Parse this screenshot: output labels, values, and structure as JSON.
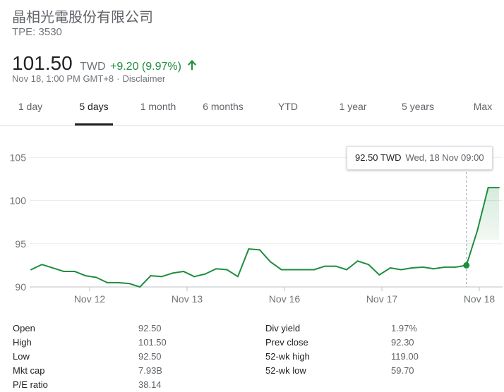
{
  "header": {
    "name": "晶相光電股份有限公司",
    "ticker": "TPE: 3530",
    "price": "101.50",
    "currency": "TWD",
    "change": "+9.20 (9.97%)",
    "timestamp": "Nov 18, 1:00 PM GMT+8",
    "separator": "·",
    "disclaimer": "Disclaimer",
    "up_color": "#1e8e3e",
    "arrow_icon": "arrow-up-icon"
  },
  "tabs": [
    {
      "label": "1 day",
      "active": false
    },
    {
      "label": "5 days",
      "active": true
    },
    {
      "label": "1 month",
      "active": false
    },
    {
      "label": "6 months",
      "active": false
    },
    {
      "label": "YTD",
      "active": false
    },
    {
      "label": "1 year",
      "active": false
    },
    {
      "label": "5 years",
      "active": false
    },
    {
      "label": "Max",
      "active": false
    }
  ],
  "tooltip": {
    "price": "92.50 TWD",
    "date": "Wed, 18 Nov 09:00"
  },
  "chart_data": {
    "type": "area",
    "y_ticks": [
      "105",
      "100",
      "95",
      "90"
    ],
    "ylim": [
      90,
      106
    ],
    "x_ticks": [
      "Nov 12",
      "Nov 13",
      "Nov 16",
      "Nov 17",
      "Nov 18"
    ],
    "series": [
      {
        "color": "#1e8e3e",
        "points": [
          [
            "Nov 11",
            92.0
          ],
          [
            "Nov 11",
            92.6
          ],
          [
            "Nov 11",
            92.2
          ],
          [
            "Nov 11",
            91.8
          ],
          [
            "Nov 12",
            91.8
          ],
          [
            "Nov 12",
            91.3
          ],
          [
            "Nov 12",
            91.1
          ],
          [
            "Nov 12",
            90.5
          ],
          [
            "Nov 12",
            90.5
          ],
          [
            "Nov 12",
            90.4
          ],
          [
            "Nov 12",
            90.0
          ],
          [
            "Nov 13",
            91.3
          ],
          [
            "Nov 13",
            91.2
          ],
          [
            "Nov 13",
            91.6
          ],
          [
            "Nov 13",
            91.8
          ],
          [
            "Nov 13",
            91.2
          ],
          [
            "Nov 13",
            91.5
          ],
          [
            "Nov 13",
            92.1
          ],
          [
            "Nov 13",
            92.0
          ],
          [
            "Nov 13",
            91.2
          ],
          [
            "Nov 13",
            94.4
          ],
          [
            "Nov 13",
            94.3
          ],
          [
            "Nov 16",
            92.9
          ],
          [
            "Nov 16",
            92.0
          ],
          [
            "Nov 16",
            92.0
          ],
          [
            "Nov 16",
            92.0
          ],
          [
            "Nov 16",
            92.0
          ],
          [
            "Nov 16",
            92.4
          ],
          [
            "Nov 16",
            92.4
          ],
          [
            "Nov 16",
            92.0
          ],
          [
            "Nov 16",
            93.0
          ],
          [
            "Nov 16",
            92.6
          ],
          [
            "Nov 17",
            91.4
          ],
          [
            "Nov 17",
            92.2
          ],
          [
            "Nov 17",
            92.0
          ],
          [
            "Nov 17",
            92.2
          ],
          [
            "Nov 17",
            92.3
          ],
          [
            "Nov 17",
            92.1
          ],
          [
            "Nov 17",
            92.3
          ],
          [
            "Nov 17",
            92.3
          ],
          [
            "Nov 18",
            92.5
          ],
          [
            "Nov 18",
            96.5
          ],
          [
            "Nov 18",
            101.5
          ],
          [
            "Nov 18",
            101.5
          ]
        ],
        "values": [
          92.0,
          92.6,
          92.2,
          91.8,
          91.8,
          91.3,
          91.1,
          90.5,
          90.5,
          90.4,
          90.0,
          91.3,
          91.2,
          91.6,
          91.8,
          91.2,
          91.5,
          92.1,
          92.0,
          91.2,
          94.4,
          94.3,
          92.9,
          92.0,
          92.0,
          92.0,
          92.0,
          92.4,
          92.4,
          92.0,
          93.0,
          92.6,
          91.4,
          92.2,
          92.0,
          92.2,
          92.3,
          92.1,
          92.3,
          92.3,
          92.5,
          96.5,
          101.5,
          101.5
        ]
      }
    ],
    "highlight_value": 92.5
  },
  "stats": {
    "left": [
      {
        "label": "Open",
        "value": "92.50"
      },
      {
        "label": "High",
        "value": "101.50"
      },
      {
        "label": "Low",
        "value": "92.50"
      },
      {
        "label": "Mkt cap",
        "value": "7.93B"
      },
      {
        "label": "P/E ratio",
        "value": "38.14"
      }
    ],
    "right": [
      {
        "label": "Div yield",
        "value": "1.97%"
      },
      {
        "label": "Prev close",
        "value": "92.30"
      },
      {
        "label": "52-wk high",
        "value": "119.00"
      },
      {
        "label": "52-wk low",
        "value": "59.70"
      }
    ]
  }
}
